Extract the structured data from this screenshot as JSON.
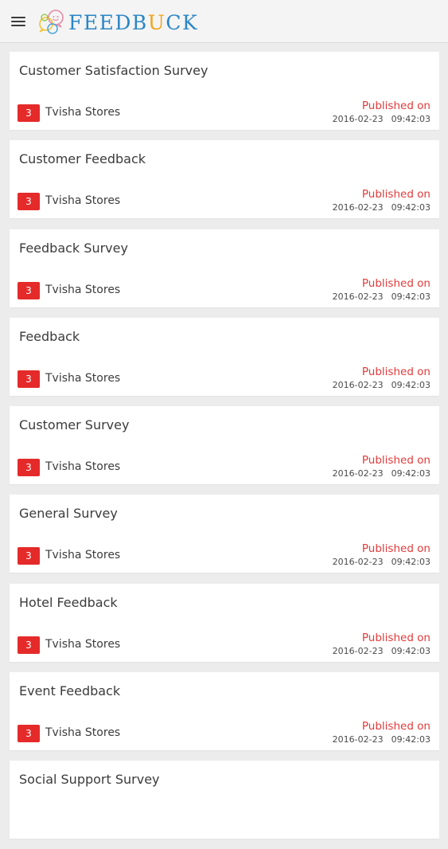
{
  "header": {
    "logo_prefix": "FEEDB",
    "logo_accent": "U",
    "logo_suffix": "CK",
    "brand_color": "#2b86c6",
    "accent_color": "#f1a51c"
  },
  "colors": {
    "badge": "#e52a2a",
    "published": "#e23a3a"
  },
  "surveys": [
    {
      "title": "Customer Satisfaction Survey",
      "badge": "3",
      "store": "Tvisha Stores",
      "published_label": "Published on",
      "date": "2016-02-23",
      "time": "09:42:03"
    },
    {
      "title": "Customer Feedback",
      "badge": "3",
      "store": "Tvisha Stores",
      "published_label": "Published on",
      "date": "2016-02-23",
      "time": "09:42:03"
    },
    {
      "title": "Feedback Survey",
      "badge": "3",
      "store": "Tvisha Stores",
      "published_label": "Published on",
      "date": "2016-02-23",
      "time": "09:42:03"
    },
    {
      "title": "Feedback",
      "badge": "3",
      "store": "Tvisha Stores",
      "published_label": "Published on",
      "date": "2016-02-23",
      "time": "09:42:03"
    },
    {
      "title": "Customer Survey",
      "badge": "3",
      "store": "Tvisha Stores",
      "published_label": "Published on",
      "date": "2016-02-23",
      "time": "09:42:03"
    },
    {
      "title": "General Survey",
      "badge": "3",
      "store": "Tvisha Stores",
      "published_label": "Published on",
      "date": "2016-02-23",
      "time": "09:42:03"
    },
    {
      "title": "Hotel Feedback",
      "badge": "3",
      "store": "Tvisha Stores",
      "published_label": "Published on",
      "date": "2016-02-23",
      "time": "09:42:03"
    },
    {
      "title": "Event Feedback",
      "badge": "3",
      "store": "Tvisha Stores",
      "published_label": "Published on",
      "date": "2016-02-23",
      "time": "09:42:03"
    },
    {
      "title": "Social Support Survey"
    }
  ]
}
